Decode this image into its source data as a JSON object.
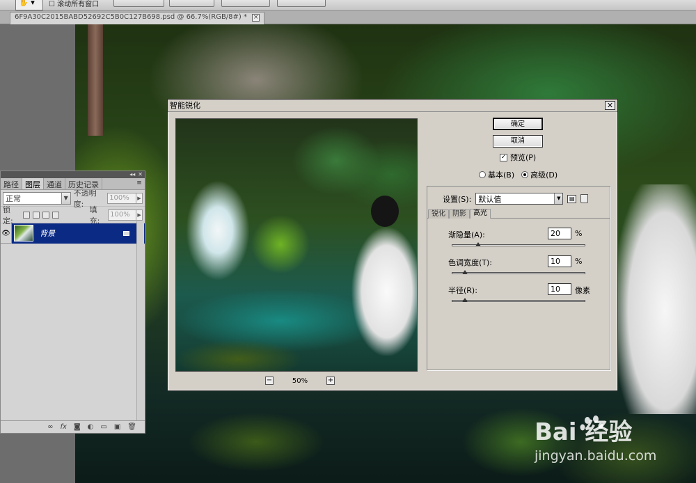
{
  "options_bar": {
    "preset": "",
    "check_label": "滚动所有窗口"
  },
  "document": {
    "tab_title": "6F9A30C2015BABD52692C5B0C127B698.psd @ 66.7%(RGB/8#) *",
    "close_glyph": "×"
  },
  "layers_panel": {
    "tabs": [
      "路径",
      "图层",
      "通道",
      "历史记录"
    ],
    "active_tab": 1,
    "blend_mode": "正常",
    "opacity_label": "不透明度:",
    "opacity_value": "100%",
    "lock_label": "锁定:",
    "fill_label": "填充:",
    "fill_value": "100%",
    "layer_name": "背景"
  },
  "dialog": {
    "title": "智能锐化",
    "ok_label": "确定",
    "cancel_label": "取消",
    "preview_label": "预览(P)",
    "preview_checked": true,
    "mode_basic": "基本(B)",
    "mode_advanced": "高级(D)",
    "selected_mode": "advanced",
    "zoom": "50%",
    "settings_label": "设置(S):",
    "settings_value": "默认值",
    "tabs": [
      "锐化",
      "阴影",
      "高光"
    ],
    "active_tab": 2,
    "sliders": [
      {
        "label": "渐隐量(A):",
        "value": "20",
        "unit": "%",
        "fraction": 0.2
      },
      {
        "label": "色调宽度(T):",
        "value": "10",
        "unit": "%",
        "fraction": 0.1
      },
      {
        "label": "半径(R):",
        "value": "10",
        "unit": "像素",
        "fraction": 0.1
      }
    ]
  },
  "watermark": {
    "logo_text": "Bai 经验",
    "url": "jingyan.baidu.com"
  }
}
